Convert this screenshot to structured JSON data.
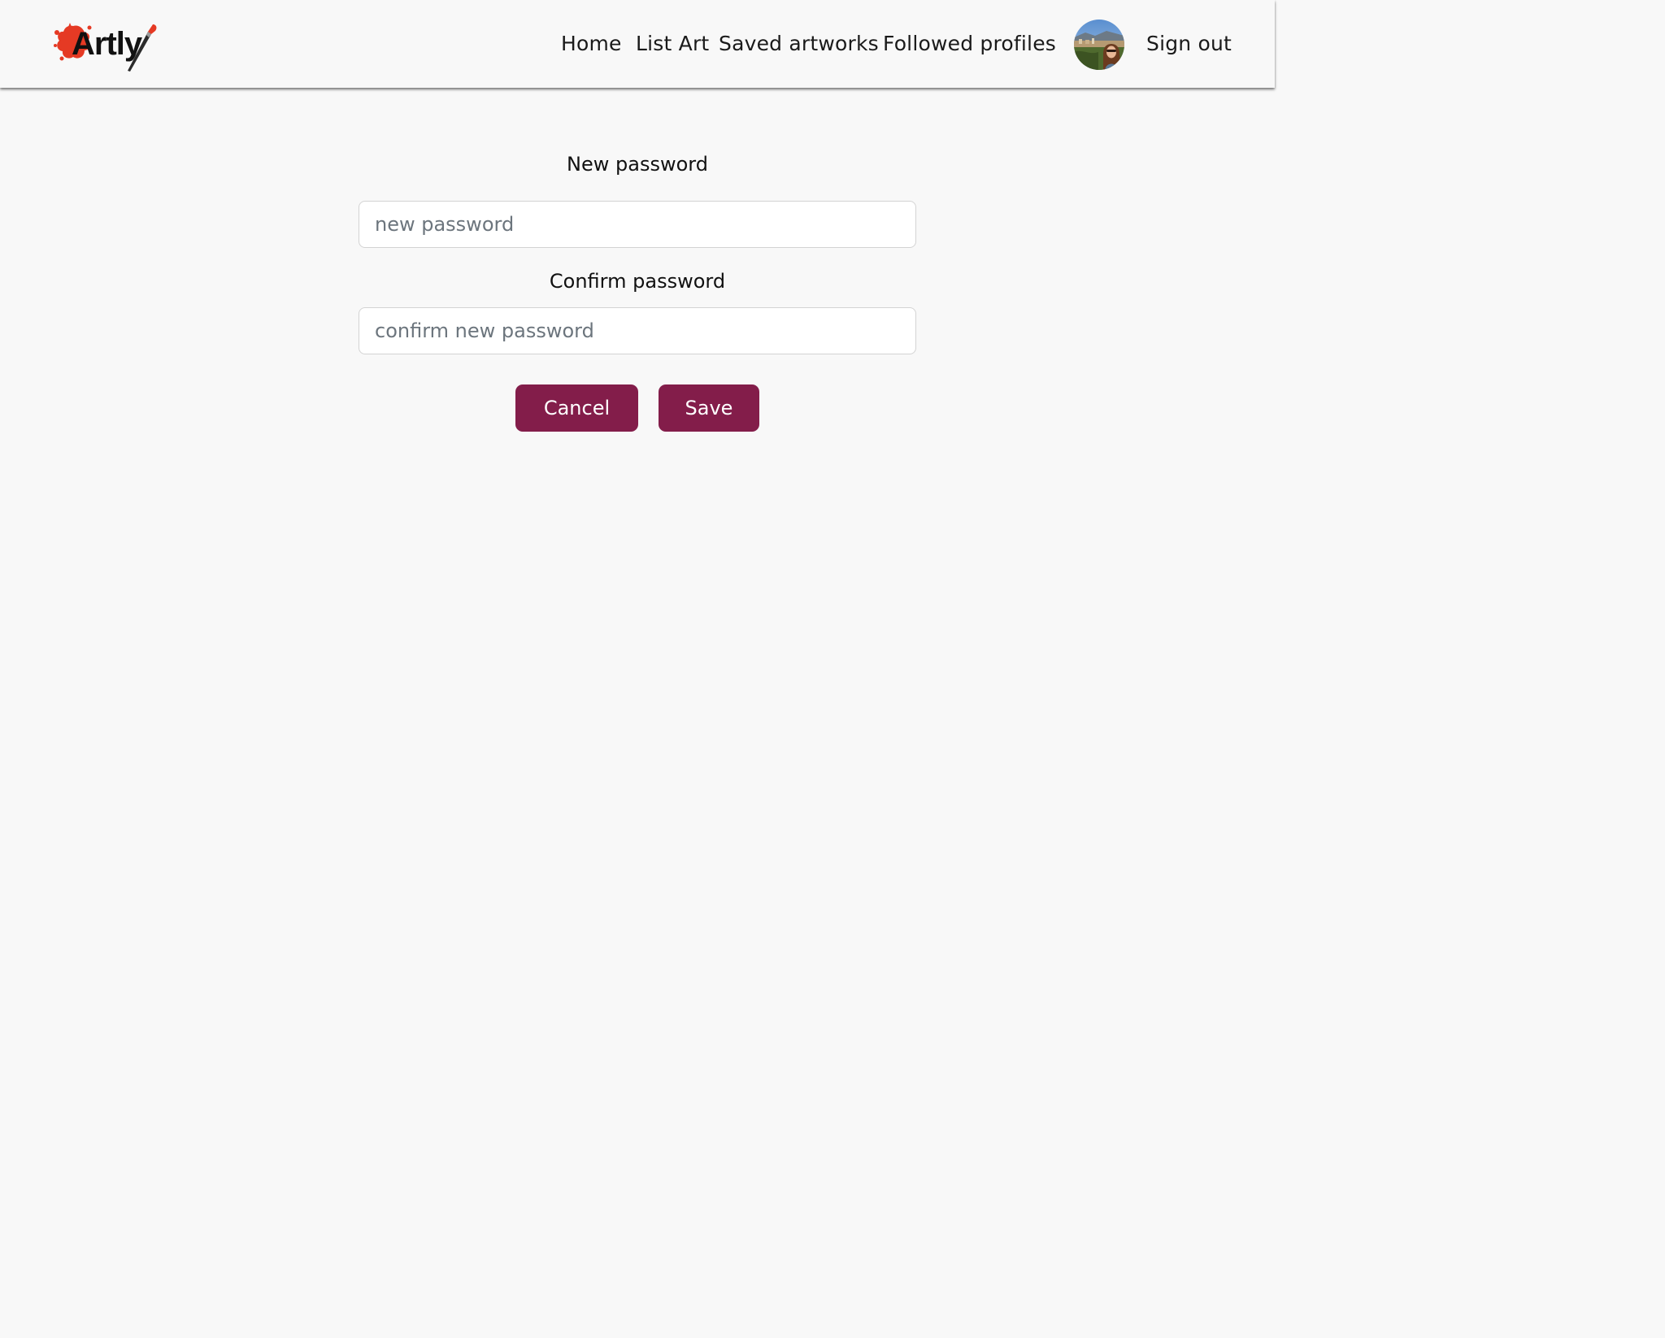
{
  "brand": {
    "name": "Artly",
    "accent_color": "#e53a24"
  },
  "nav": {
    "items": [
      {
        "label": "Home"
      },
      {
        "label": "List Art"
      },
      {
        "label": "Saved artworks"
      },
      {
        "label": "Followed profiles"
      }
    ],
    "avatar_icon": "user-avatar",
    "sign_out_label": "Sign out"
  },
  "form": {
    "new_password": {
      "label": "New password",
      "placeholder": "new password",
      "value": ""
    },
    "confirm_password": {
      "label": "Confirm password",
      "placeholder": "confirm new password",
      "value": ""
    },
    "cancel_label": "Cancel",
    "save_label": "Save",
    "button_color": "#831d4a"
  }
}
